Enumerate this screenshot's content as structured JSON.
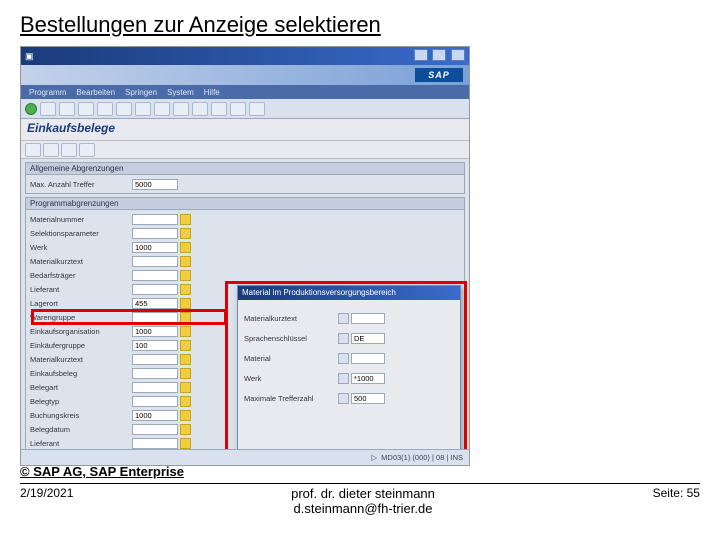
{
  "slide": {
    "title": "Bestellungen zur Anzeige selektieren",
    "copyright": "© SAP AG, SAP Enterprise",
    "footer_date": "2/19/2021",
    "footer_name": "prof. dr. dieter steinmann",
    "footer_email": "d.steinmann@fh-trier.de",
    "footer_page": "Seite: 55"
  },
  "sap": {
    "logo": "SAP",
    "menubar": [
      "Programm",
      "Bearbeiten",
      "Springen",
      "System",
      "Hilfe"
    ],
    "subtitle": "Einkaufsbelege",
    "group1": {
      "title": "Allgemeine Abgrenzungen",
      "row": {
        "label": "Max. Anzahl Treffer",
        "value": "5000"
      }
    },
    "group2": {
      "title": "Programmabgrenzungen",
      "rows": [
        {
          "label": "Materialnummer",
          "value": ""
        },
        {
          "label": "Selektionsparameter",
          "value": ""
        },
        {
          "label": "Werk",
          "value": "1000"
        },
        {
          "label": "Materialkurztext",
          "value": ""
        },
        {
          "label": "Bedarfsträger",
          "value": ""
        },
        {
          "label": "Lieferant",
          "value": ""
        },
        {
          "label": "Lagerort",
          "value": "455"
        },
        {
          "label": "Warengruppe",
          "value": ""
        },
        {
          "label": "Einkaufsorganisation",
          "value": "1000"
        },
        {
          "label": "Einkäufergruppe",
          "value": "100"
        },
        {
          "label": "Materialkurztext",
          "value": ""
        },
        {
          "label": "Einkaufsbeleg",
          "value": ""
        },
        {
          "label": "Belegart",
          "value": ""
        },
        {
          "label": "Belegtyp",
          "value": ""
        },
        {
          "label": "Buchungskreis",
          "value": "1000"
        },
        {
          "label": "Belegdatum",
          "value": ""
        },
        {
          "label": "Lieferant",
          "value": ""
        }
      ]
    },
    "popup": {
      "title": "Material im Produktionsversorgungsbereich",
      "rows": [
        {
          "label": "Materialkurztext",
          "value": ""
        },
        {
          "label": "Sprachenschlüssel",
          "value": "DE"
        },
        {
          "label": "Material",
          "value": ""
        },
        {
          "label": "Werk",
          "value": "*1000"
        },
        {
          "label": "Maximale Trefferzahl",
          "value": "500"
        }
      ]
    },
    "status": "MD03(1) (000) | 08 | INS"
  }
}
